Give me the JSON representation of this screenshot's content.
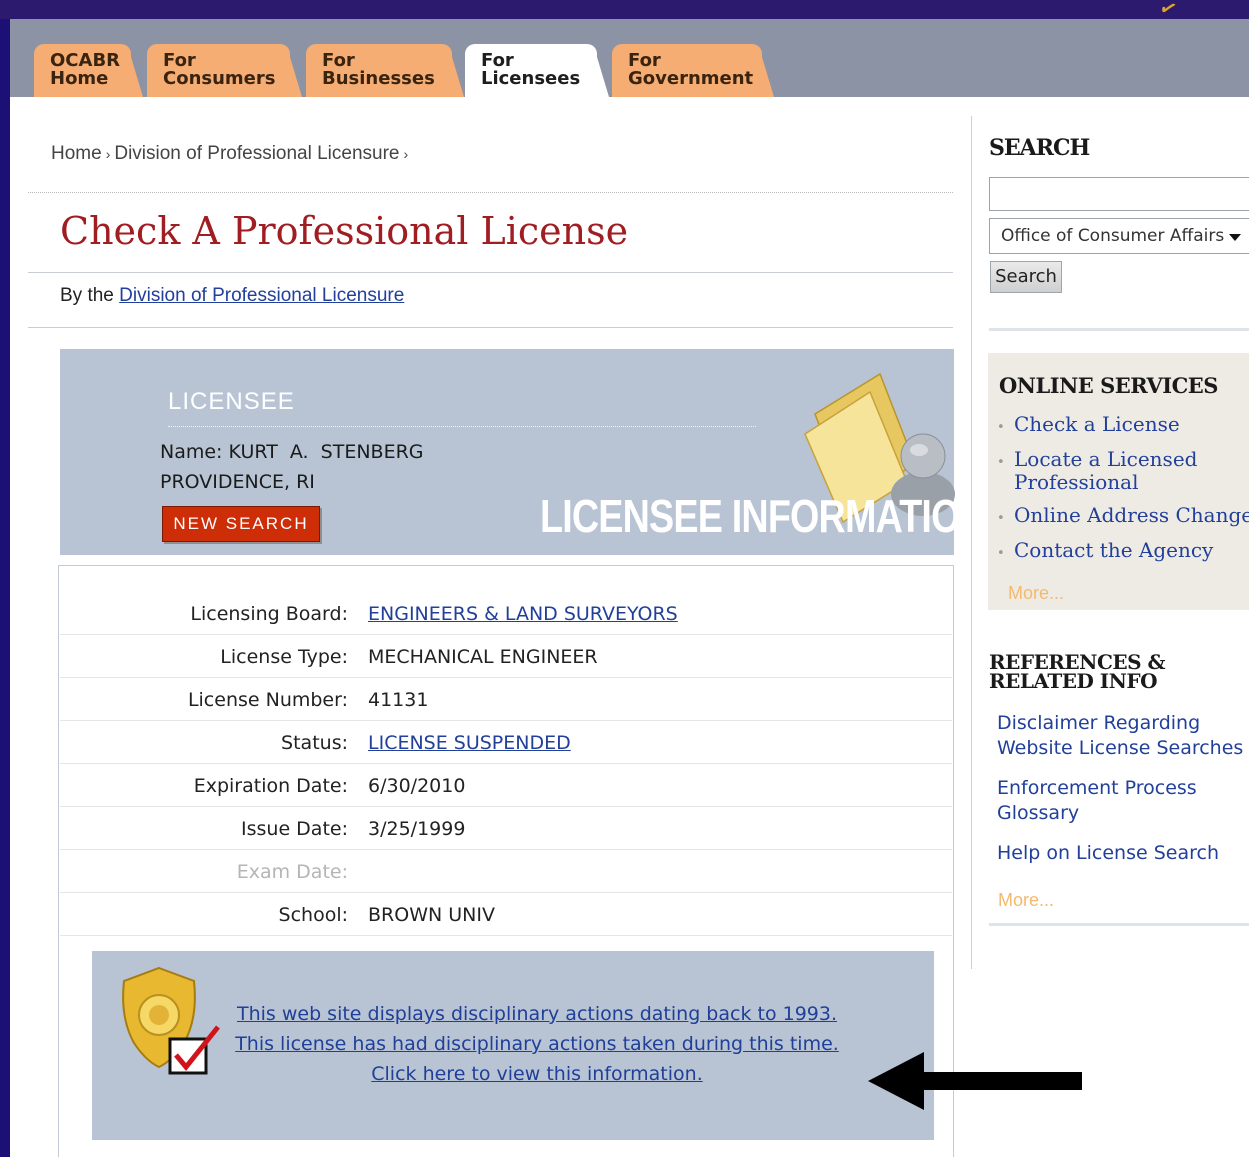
{
  "nav": {
    "tabs": [
      {
        "line1": "OCABR",
        "line2": "Home"
      },
      {
        "line1": "For",
        "line2": "Consumers"
      },
      {
        "line1": "For",
        "line2": "Businesses"
      },
      {
        "line1": "For",
        "line2": "Licensees"
      },
      {
        "line1": "For",
        "line2": "Government"
      }
    ],
    "active_tab": "For Licensees"
  },
  "breadcrumb": {
    "items": [
      "Home",
      "Division of Professional Licensure"
    ],
    "separator": "›"
  },
  "page": {
    "title": "Check A Professional License",
    "byline_prefix": "By the",
    "byline_link": "Division of Professional Licensure"
  },
  "licensee": {
    "heading": "LICENSEE",
    "name_label": "Name:",
    "name": "KURT  A.  STENBERG",
    "city": "PROVIDENCE, RI",
    "new_search_label": "NEW SEARCH",
    "banner_text": "LICENSEE INFORMATION"
  },
  "details": [
    {
      "label": "Licensing Board:",
      "value": "ENGINEERS & LAND SURVEYORS",
      "link": true
    },
    {
      "label": "License Type:",
      "value": "MECHANICAL ENGINEER",
      "link": false
    },
    {
      "label": "License Number:",
      "value": "41131",
      "link": false
    },
    {
      "label": "Status:",
      "value": "LICENSE SUSPENDED",
      "link": true
    },
    {
      "label": "Expiration Date:",
      "value": "6/30/2010",
      "link": false
    },
    {
      "label": "Issue Date:",
      "value": "3/25/1999",
      "link": false
    },
    {
      "label": "Exam Date:",
      "value": "",
      "link": false,
      "dim": true
    },
    {
      "label": "School:",
      "value": "BROWN UNIV",
      "link": false
    }
  ],
  "disciplinary": {
    "lines": [
      "This web site displays disciplinary actions dating back to 1993.",
      "This license has had disciplinary actions taken during this time.",
      "Click here to view this information."
    ]
  },
  "sidebar": {
    "search_heading": "SEARCH",
    "search_value": "",
    "scope_selected": "Office of Consumer Affairs",
    "search_button": "Search",
    "online_services": {
      "heading": "ONLINE SERVICES",
      "items": [
        {
          "line1": "Check a License",
          "line2": ""
        },
        {
          "line1": "Locate a Licensed",
          "line2": "Professional"
        },
        {
          "line1": "Online Address Change",
          "line2": ""
        },
        {
          "line1": "Contact the Agency",
          "line2": ""
        }
      ],
      "more": "More..."
    },
    "references": {
      "heading_line1": "REFERENCES &",
      "heading_line2": "RELATED INFO",
      "links": [
        {
          "line1": "Disclaimer Regarding",
          "line2": "Website License Searches"
        },
        {
          "line1": "Enforcement Process",
          "line2": "Glossary"
        },
        {
          "line1": "Help on License Search",
          "line2": ""
        }
      ],
      "more": "More..."
    }
  },
  "colors": {
    "frame": "#1c1076",
    "tab": "#f5ad74",
    "title_red": "#a01d22",
    "link_blue": "#22409a",
    "panel_blue": "#b8c4d4",
    "button_red": "#cd2d07"
  }
}
